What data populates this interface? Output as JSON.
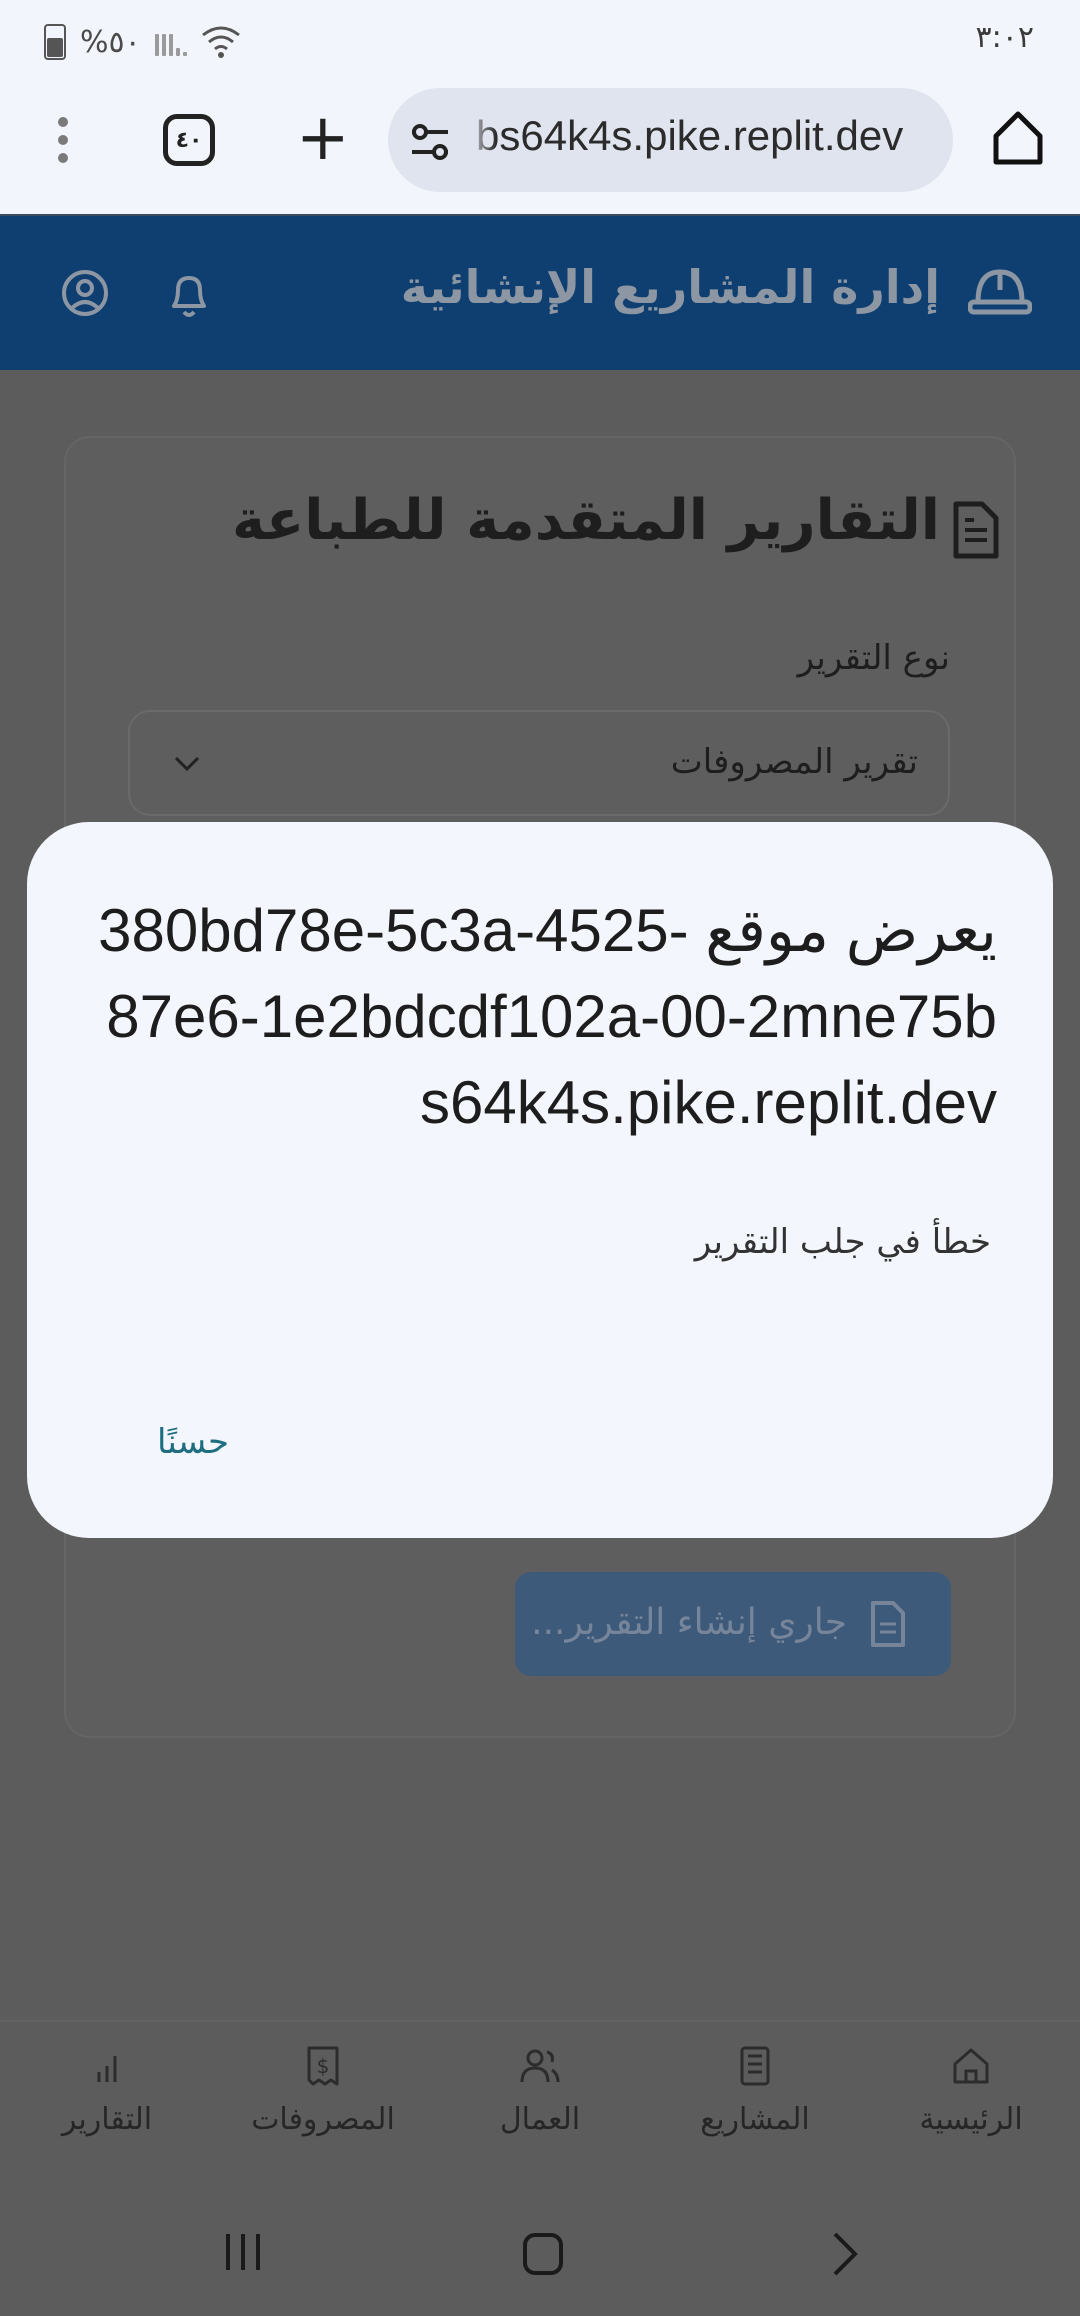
{
  "status_bar": {
    "time": "٣:٠٢",
    "battery_text": "%٥٠"
  },
  "browser": {
    "url": "380bd78e-5c3a-4525-87e6-1e2bdcdf102a-00-2mne75bs64k4s.pike.replit.dev",
    "url_visible": "bs64k4s.pike.replit.dev",
    "tab_count": "٤٠"
  },
  "app_header": {
    "title": "إدارة المشاريع الإنشائية"
  },
  "report_card": {
    "title": "التقارير المتقدمة للطباعة",
    "type_label": "نوع التقرير",
    "type_selected": "تقرير المصروفات",
    "generate_button": "جاري إنشاء التقرير..."
  },
  "dialog": {
    "title": "يعرض موقع 380bd78e-5c3a-4525-87e6-1e2bdcdf102a-00-2mne75bs64k4s.pike.replit.dev",
    "message": "خطأ في جلب التقرير",
    "ok_label": "حسنًا"
  },
  "bottom_nav": {
    "items": [
      {
        "label": "الرئيسية",
        "icon": "home-icon"
      },
      {
        "label": "المشاريع",
        "icon": "building-icon"
      },
      {
        "label": "العمال",
        "icon": "users-icon"
      },
      {
        "label": "المصروفات",
        "icon": "receipt-icon"
      },
      {
        "label": "التقارير",
        "icon": "bar-chart-icon"
      }
    ]
  },
  "colors": {
    "header_bg": "#0f3f71",
    "dialog_bg": "#f3f6fc",
    "ok_color": "#1f6e80",
    "overlay": "#5c5c5c"
  }
}
